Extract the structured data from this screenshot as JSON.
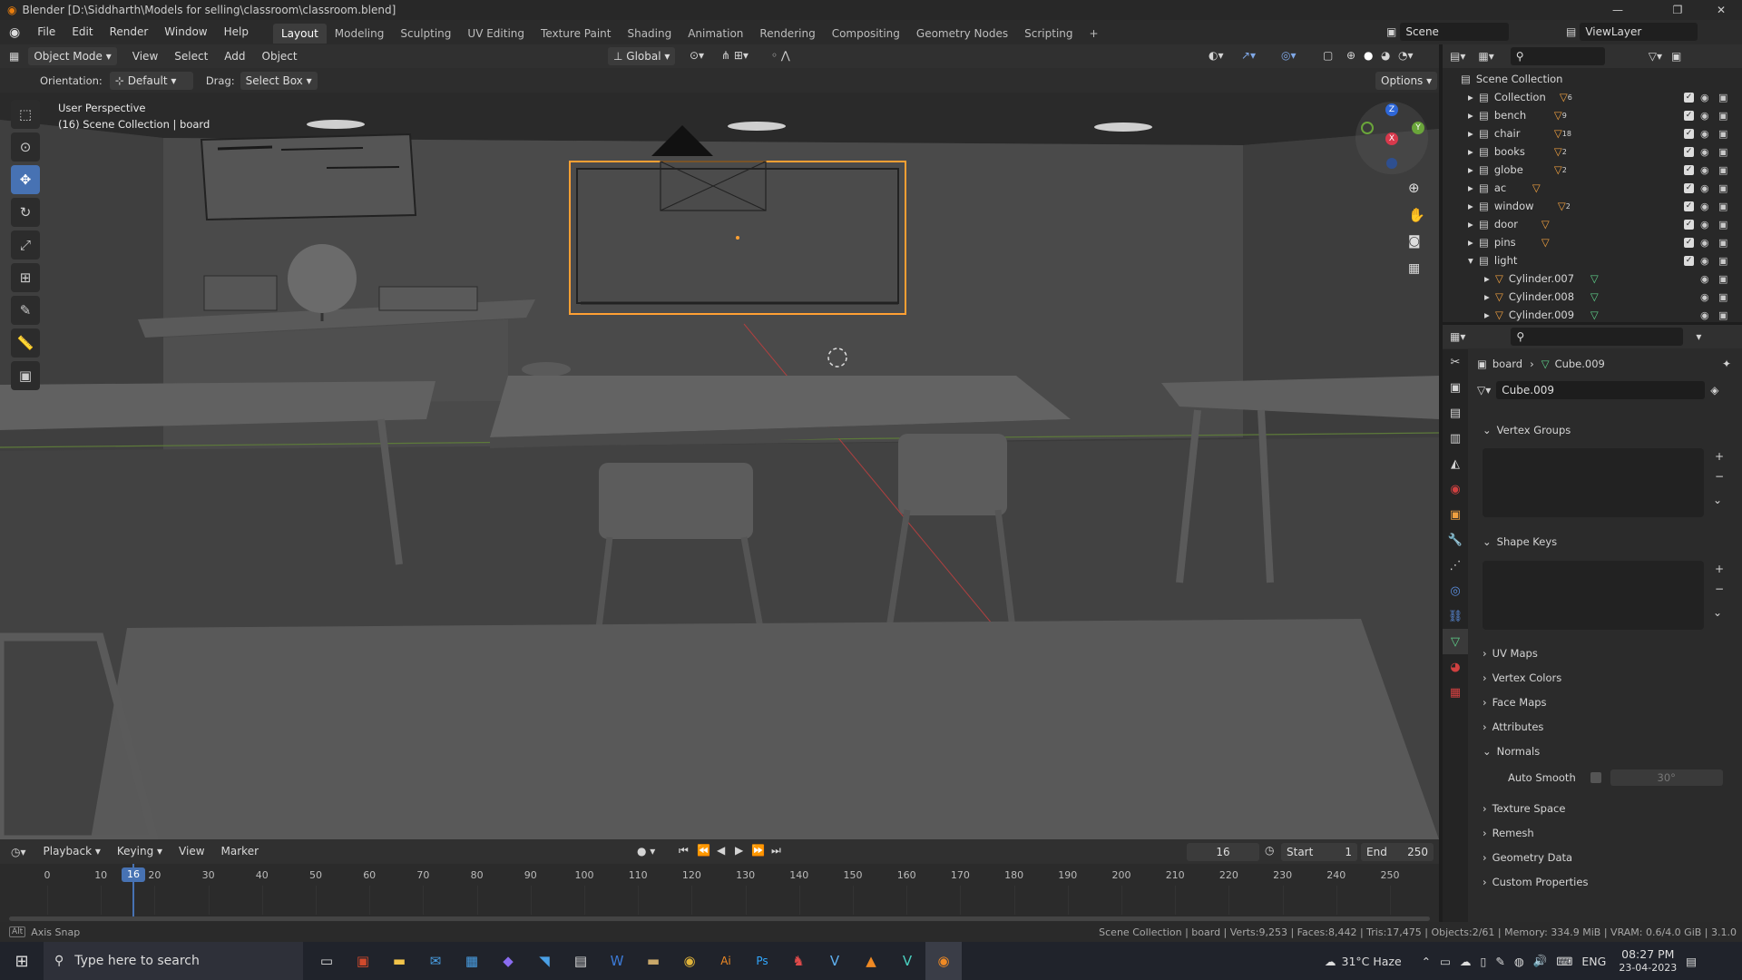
{
  "window": {
    "title": "Blender [D:\\Siddharth\\Models for selling\\classroom\\classroom.blend]",
    "min": "—",
    "max": "❐",
    "close": "✕"
  },
  "topbar": {
    "menus": [
      "File",
      "Edit",
      "Render",
      "Window",
      "Help"
    ],
    "workspaces": [
      "Layout",
      "Modeling",
      "Sculpting",
      "UV Editing",
      "Texture Paint",
      "Shading",
      "Animation",
      "Rendering",
      "Compositing",
      "Geometry Nodes",
      "Scripting",
      "+"
    ],
    "active_workspace": "Layout",
    "scene": "Scene",
    "view_layer": "ViewLayer"
  },
  "viewport_header": {
    "mode": "Object Mode",
    "menus": [
      "View",
      "Select",
      "Add",
      "Object"
    ],
    "transform_orientation": "Global",
    "orientation_label": "Orientation:",
    "orientation_value": "Default",
    "drag_label": "Drag:",
    "drag_value": "Select Box",
    "options": "Options"
  },
  "viewport": {
    "perspective": "User Perspective",
    "collection_info": "(16) Scene Collection | board"
  },
  "outliner": {
    "root": "Scene Collection",
    "items": [
      {
        "name": "Collection",
        "badge": "6"
      },
      {
        "name": "bench",
        "badge": "9"
      },
      {
        "name": "chair",
        "badge": "18"
      },
      {
        "name": "books",
        "badge": "2"
      },
      {
        "name": "globe",
        "badge": "2"
      },
      {
        "name": "ac",
        "badge": ""
      },
      {
        "name": "window",
        "badge": "2"
      },
      {
        "name": "door",
        "badge": ""
      },
      {
        "name": "pins",
        "badge": ""
      },
      {
        "name": "light",
        "badge": ""
      }
    ],
    "children": [
      "Cylinder.007",
      "Cylinder.008",
      "Cylinder.009"
    ]
  },
  "properties": {
    "breadcrumb_object": "board",
    "breadcrumb_mesh": "Cube.009",
    "mesh_name": "Cube.009",
    "sections": {
      "vertex_groups": "Vertex Groups",
      "shape_keys": "Shape Keys",
      "uv_maps": "UV Maps",
      "vertex_colors": "Vertex Colors",
      "face_maps": "Face Maps",
      "attributes": "Attributes",
      "normals": "Normals",
      "auto_smooth": "Auto Smooth",
      "auto_smooth_angle": "30°",
      "texture_space": "Texture Space",
      "remesh": "Remesh",
      "geometry_data": "Geometry Data",
      "custom_properties": "Custom Properties"
    }
  },
  "timeline": {
    "menus": [
      "Playback",
      "Keying",
      "View",
      "Marker"
    ],
    "current_frame": "16",
    "start_label": "Start",
    "start": "1",
    "end_label": "End",
    "end": "250",
    "ticks": [
      "0",
      "10",
      "20",
      "30",
      "40",
      "50",
      "60",
      "70",
      "80",
      "90",
      "100",
      "110",
      "120",
      "130",
      "140",
      "150",
      "160",
      "170",
      "180",
      "190",
      "200",
      "210",
      "220",
      "230",
      "240",
      "250"
    ]
  },
  "status": {
    "left": "Axis Snap",
    "right": "Scene Collection | board | Verts:9,253 | Faces:8,442 | Tris:17,475 | Objects:2/61 | Memory: 334.9 MiB | VRAM: 0.6/4.0 GiB | 3.1.0"
  },
  "taskbar": {
    "search_placeholder": "Type here to search",
    "weather": "31°C  Haze",
    "lang": "ENG",
    "time": "08:27 PM",
    "date": "23-04-2023"
  },
  "colors": {
    "accent": "#4772b3",
    "selection": "#ffa033",
    "background": "#3a3a3a"
  }
}
